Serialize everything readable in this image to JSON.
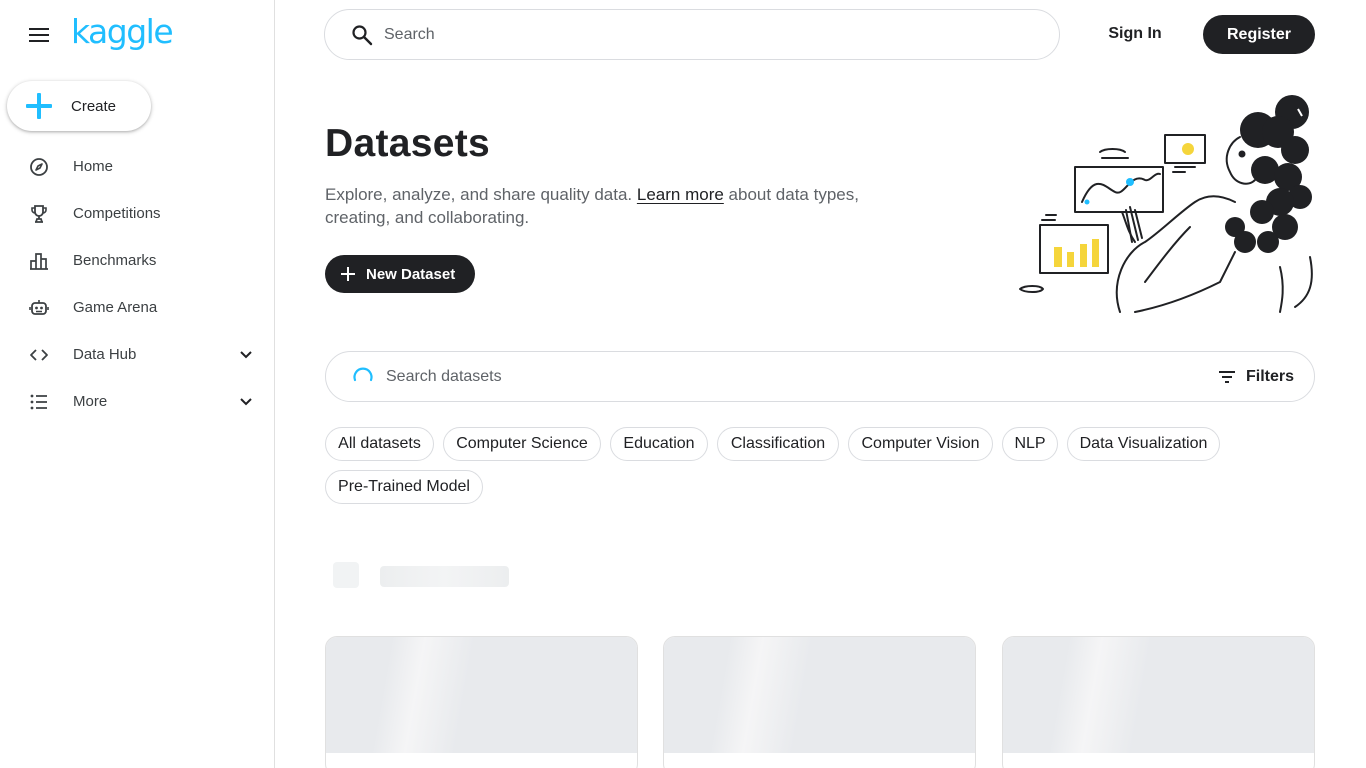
{
  "brand": {
    "logo_text": "kaggle",
    "accent": "#20beff",
    "dark": "#202124"
  },
  "sidebar": {
    "create_label": "Create",
    "items": [
      {
        "label": "Home",
        "icon": "compass-icon"
      },
      {
        "label": "Competitions",
        "icon": "trophy-icon"
      },
      {
        "label": "Benchmarks",
        "icon": "bar-chart-icon"
      },
      {
        "label": "Game Arena",
        "icon": "robot-icon"
      },
      {
        "label": "Data Hub",
        "icon": "code-brackets-icon",
        "expandable": true
      },
      {
        "label": "More",
        "icon": "list-icon",
        "expandable": true
      }
    ]
  },
  "topbar": {
    "search_placeholder": "Search",
    "signin_label": "Sign In",
    "register_label": "Register"
  },
  "hero": {
    "title": "Datasets",
    "desc_before": "Explore, analyze, and share quality data. ",
    "desc_link": "Learn more",
    "desc_after": " about data types, creating, and collaborating.",
    "new_dataset_label": "New Dataset"
  },
  "dataset_search": {
    "placeholder": "Search datasets",
    "filters_label": "Filters"
  },
  "chips": [
    "All datasets",
    "Computer Science",
    "Education",
    "Classification",
    "Computer Vision",
    "NLP",
    "Data Visualization",
    "Pre-Trained Model"
  ]
}
